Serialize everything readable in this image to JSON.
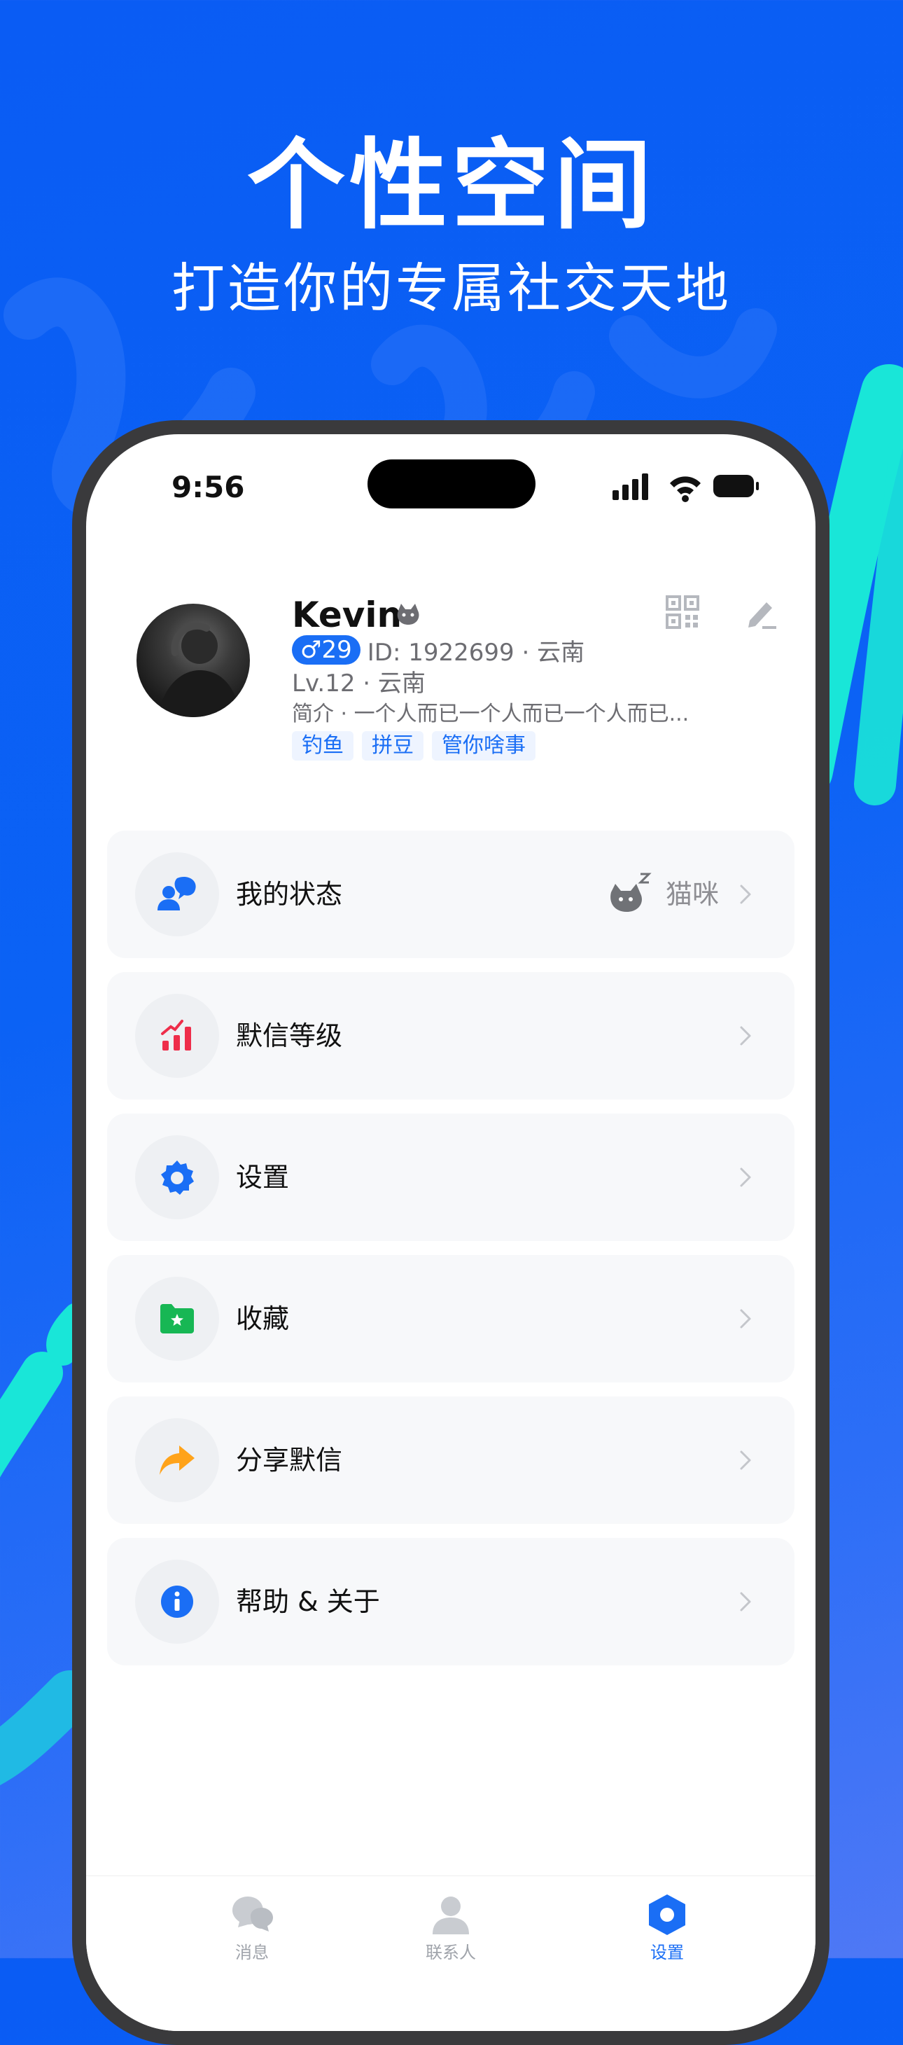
{
  "hero": {
    "title": "个性空间",
    "subtitle": "打造你的专属社交天地"
  },
  "status_bar": {
    "time": "9:56"
  },
  "profile": {
    "name": "Kevin",
    "gender_age": "♂29",
    "id_line": "ID: 1922699 · 云南",
    "level_line": "Lv.12 · 云南",
    "bio": "简介 · 一个人而已一个人而已一个人而已...",
    "tags": [
      "钓鱼",
      "拼豆",
      "管你啥事"
    ]
  },
  "menu": {
    "items": [
      {
        "label": "我的状态",
        "icon": "people-chat-icon",
        "value": "猫咪"
      },
      {
        "label": "默信等级",
        "icon": "level-chart-icon"
      },
      {
        "label": "设置",
        "icon": "gear-icon"
      },
      {
        "label": "收藏",
        "icon": "star-folder-icon"
      },
      {
        "label": "分享默信",
        "icon": "share-arrow-icon"
      },
      {
        "label": "帮助 & 关于",
        "icon": "info-icon"
      }
    ]
  },
  "tabbar": {
    "tabs": [
      {
        "label": "消息",
        "icon": "chat-bubbles-icon"
      },
      {
        "label": "联系人",
        "icon": "contact-person-icon"
      },
      {
        "label": "设置",
        "icon": "settings-hexagon-icon",
        "active": true
      }
    ]
  },
  "colors": {
    "brand_blue": "#1a6ef5",
    "background_blue": "#0a5cf4",
    "accent_cyan": "#19e6d8",
    "level_red": "#ee2d4a",
    "favorite_green": "#17b754",
    "share_orange": "#ffa31a"
  }
}
